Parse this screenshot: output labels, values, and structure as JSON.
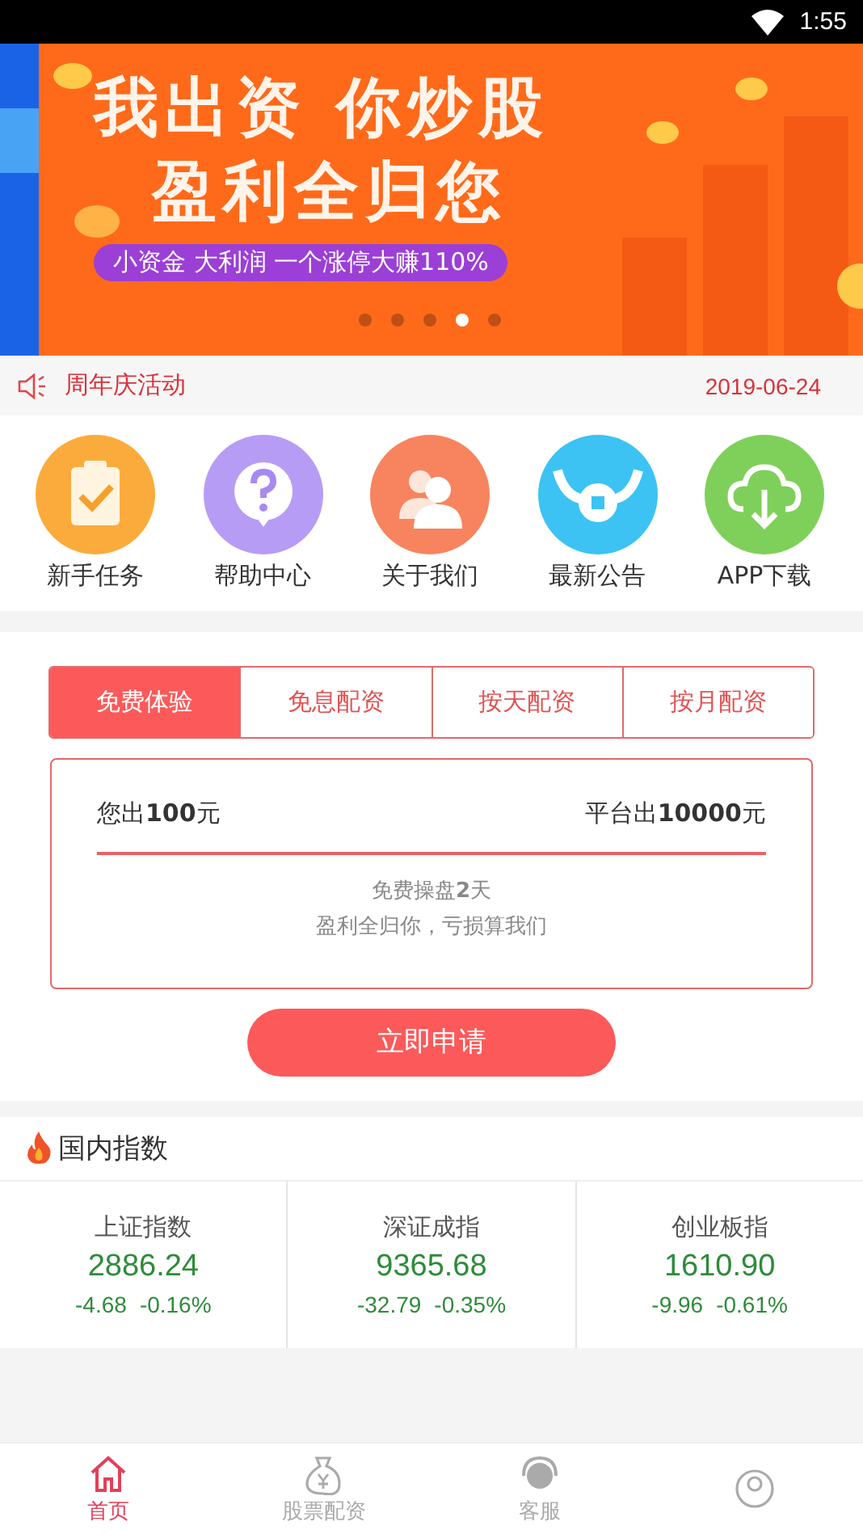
{
  "status_bar": {
    "time": "1:55"
  },
  "banner": {
    "headline_1": "我出资 你炒股",
    "headline_2": "盈利全归您",
    "tagline": "小资金 大利润 一个涨停大赚110%",
    "dots": [
      {
        "selected": false
      },
      {
        "selected": false
      },
      {
        "selected": false
      },
      {
        "selected": true
      },
      {
        "selected": false
      }
    ]
  },
  "notice": {
    "title": "周年庆活动",
    "date": "2019-06-24"
  },
  "shortcuts": [
    {
      "kind": "task",
      "label": "新手任务",
      "color": "#fbab3c"
    },
    {
      "kind": "help",
      "label": "帮助中心",
      "color": "#b79cf5"
    },
    {
      "kind": "about",
      "label": "关于我们",
      "color": "#f7845e"
    },
    {
      "kind": "notice",
      "label": "最新公告",
      "color": "#3cc3f3"
    },
    {
      "kind": "download",
      "label": "APP下载",
      "color": "#7fd05a"
    }
  ],
  "plan_tabs": [
    {
      "label": "免费体验",
      "selected": true
    },
    {
      "label": "免息配资",
      "selected": false
    },
    {
      "label": "按天配资",
      "selected": false
    },
    {
      "label": "按月配资",
      "selected": false
    }
  ],
  "plan": {
    "you_pay": "您出**100**元",
    "platform_pays": "平台出**10000**元",
    "term": "免费操盘**2**天",
    "note": "盈利全归你，亏损算我们"
  },
  "apply_button": "立即申请",
  "indices": {
    "title": "国内指数",
    "items": [
      {
        "name": "上证指数",
        "value": "2886.24",
        "change": "-4.68",
        "percent": "-0.16%"
      },
      {
        "name": "深证成指",
        "value": "9365.68",
        "change": "-32.79",
        "percent": "-0.35%"
      },
      {
        "name": "创业板指",
        "value": "1610.90",
        "change": "-9.96",
        "percent": "-0.61%"
      }
    ]
  },
  "tab_bar": [
    {
      "kind": "home",
      "label": "首页",
      "selected": true
    },
    {
      "kind": "money",
      "label": "股票配资",
      "selected": false
    },
    {
      "kind": "service",
      "label": "客服",
      "selected": false
    },
    {
      "kind": "user",
      "selected": false
    }
  ]
}
